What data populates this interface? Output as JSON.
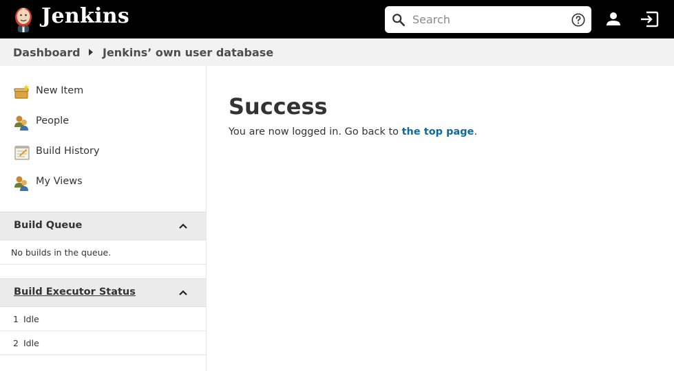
{
  "header": {
    "brand": "Jenkins",
    "search_placeholder": "Search"
  },
  "breadcrumb": {
    "items": [
      "Dashboard",
      "Jenkins’ own user database"
    ]
  },
  "sidebar": {
    "tasks": [
      {
        "label": "New Item",
        "icon": "new-item-icon"
      },
      {
        "label": "People",
        "icon": "people-icon"
      },
      {
        "label": "Build History",
        "icon": "notepad-icon"
      },
      {
        "label": "My Views",
        "icon": "people-icon"
      }
    ],
    "build_queue": {
      "title": "Build Queue",
      "empty_text": "No builds in the queue."
    },
    "executors": {
      "title": "Build Executor Status",
      "rows": [
        {
          "num": "1",
          "status": "Idle"
        },
        {
          "num": "2",
          "status": "Idle"
        }
      ]
    }
  },
  "main": {
    "title": "Success",
    "message_prefix": "You are now logged in. Go back to ",
    "link_text": "the top page",
    "message_suffix": "."
  },
  "colors": {
    "header_bg": "#000000",
    "link": "#0b6aa2",
    "breadcrumb_bg": "#f2f2f2",
    "pane_header_bg": "#ebebeb"
  }
}
